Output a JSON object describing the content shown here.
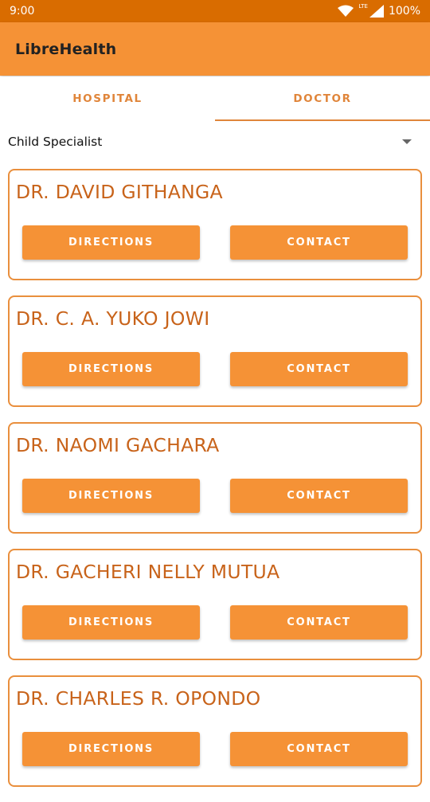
{
  "status_bar": {
    "time": "9:00",
    "battery": "100%",
    "network": "LTE"
  },
  "app_bar": {
    "title": "LibreHealth"
  },
  "tabs": [
    {
      "label": "HOSPITAL",
      "active": false
    },
    {
      "label": "DOCTOR",
      "active": true
    }
  ],
  "spinner": {
    "selected": "Child Specialist"
  },
  "doctors": [
    {
      "name": "DR. DAVID GITHANGA",
      "directions_label": "DIRECTIONS",
      "contact_label": "CONTACT"
    },
    {
      "name": "DR. C. A. YUKO JOWI",
      "directions_label": "DIRECTIONS",
      "contact_label": "CONTACT"
    },
    {
      "name": "DR. NAOMI GACHARA",
      "directions_label": "DIRECTIONS",
      "contact_label": "CONTACT"
    },
    {
      "name": "DR. GACHERI NELLY MUTUA",
      "directions_label": "DIRECTIONS",
      "contact_label": "CONTACT"
    },
    {
      "name": "DR. CHARLES R. OPONDO",
      "directions_label": "DIRECTIONS",
      "contact_label": "CONTACT"
    }
  ],
  "colors": {
    "status_bar": "#D96C00",
    "app_bar": "#F59236",
    "accent": "#E0853A",
    "doctor_name": "#C8631A",
    "button": "#F59236"
  }
}
